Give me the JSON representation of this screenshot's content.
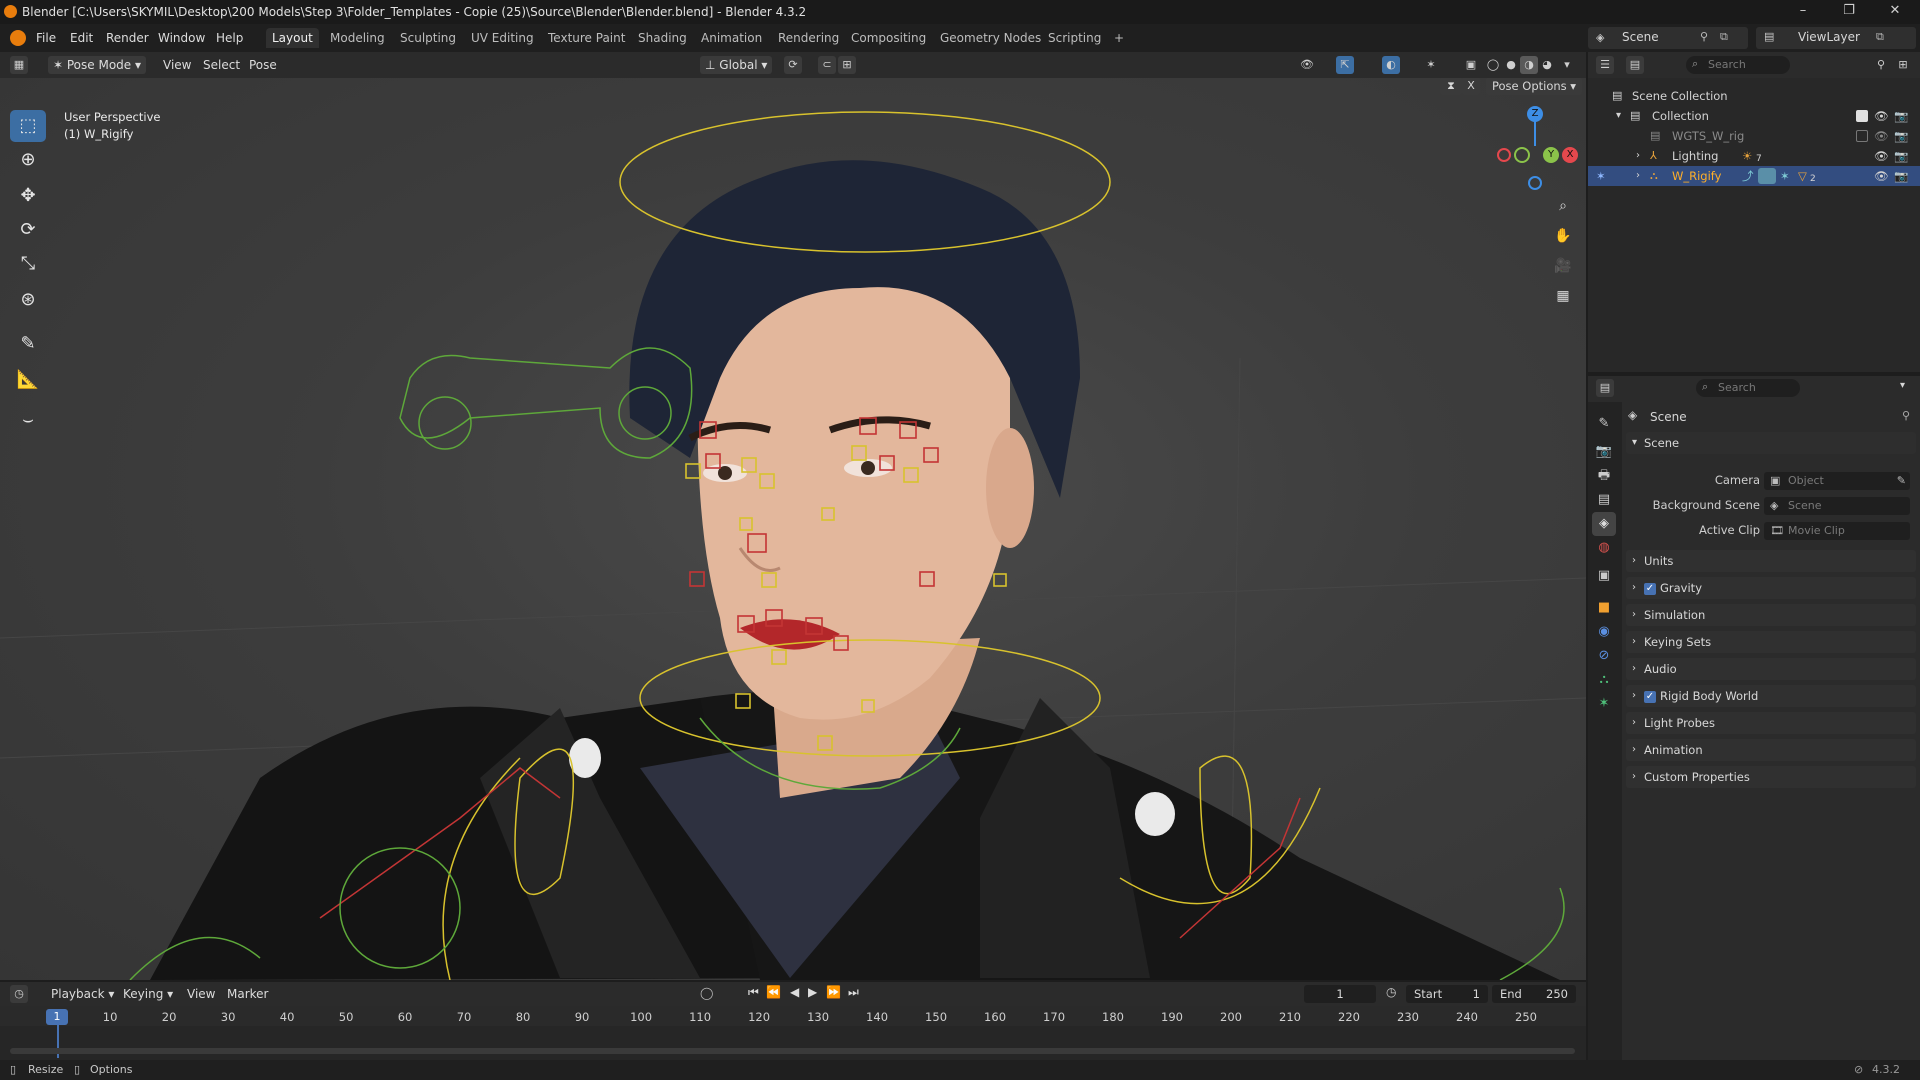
{
  "window": {
    "title": "Blender [C:\\Users\\SKYMIL\\Desktop\\200 Models\\Step 3\\Folder_Templates - Copie (25)\\Source\\Blender\\Blender.blend] - Blender 4.3.2",
    "controls": [
      "–",
      "❐",
      "✕"
    ]
  },
  "menubar": {
    "menus": [
      "File",
      "Edit",
      "Render",
      "Window",
      "Help"
    ],
    "workspaces": [
      "Layout",
      "Modeling",
      "Sculpting",
      "UV Editing",
      "Texture Paint",
      "Shading",
      "Animation",
      "Rendering",
      "Compositing",
      "Geometry Nodes",
      "Scripting"
    ],
    "active_workspace": "Layout",
    "add_tab": "+",
    "scene": "Scene",
    "view_layer": "ViewLayer"
  },
  "viewport_header": {
    "mode": "Pose Mode",
    "menus": [
      "View",
      "Select",
      "Pose"
    ],
    "orientation": "Global",
    "pose_options": "Pose Options"
  },
  "viewport": {
    "overlay_line1": "User Perspective",
    "overlay_line2": "(1) W_Rigify",
    "gizmo_axes": [
      "Z",
      "Y",
      "X"
    ],
    "accent_colors": {
      "x": "#e5484d",
      "y": "#8bc34a",
      "z": "#3d8ee6"
    }
  },
  "tools": [
    "select-box",
    "cursor",
    "move",
    "rotate",
    "scale",
    "transform",
    "annotate",
    "measure",
    "bone-relax"
  ],
  "outliner": {
    "search_placeholder": "Search",
    "root": "Scene Collection",
    "rows": [
      {
        "name": "Collection",
        "level": 1
      },
      {
        "name": "WGTS_W_rig",
        "level": 2
      },
      {
        "name": "Lighting",
        "level": 2,
        "badge": "7"
      },
      {
        "name": "W_Rigify",
        "level": 2,
        "badge": "2",
        "selected": true
      }
    ]
  },
  "properties": {
    "search_placeholder": "Search",
    "context": "Scene",
    "section": "Scene",
    "fields": [
      {
        "label": "Camera",
        "placeholder": "Object"
      },
      {
        "label": "Background Scene",
        "placeholder": "Scene"
      },
      {
        "label": "Active Clip",
        "placeholder": "Movie Clip"
      }
    ],
    "panels": [
      {
        "label": "Units",
        "checkbox": false
      },
      {
        "label": "Gravity",
        "checkbox": true
      },
      {
        "label": "Simulation",
        "checkbox": false
      },
      {
        "label": "Keying Sets",
        "checkbox": false
      },
      {
        "label": "Audio",
        "checkbox": false
      },
      {
        "label": "Rigid Body World",
        "checkbox": true
      },
      {
        "label": "Light Probes",
        "checkbox": false
      },
      {
        "label": "Animation",
        "checkbox": false
      },
      {
        "label": "Custom Properties",
        "checkbox": false
      }
    ]
  },
  "timeline": {
    "menus": [
      "Playback",
      "Keying",
      "View",
      "Marker"
    ],
    "current_frame": "1",
    "start_label": "Start",
    "start": "1",
    "end_label": "End",
    "end": "250",
    "ticks": [
      "1",
      "10",
      "20",
      "30",
      "40",
      "50",
      "60",
      "70",
      "80",
      "90",
      "100",
      "110",
      "120",
      "130",
      "140",
      "150",
      "160",
      "170",
      "180",
      "190",
      "200",
      "210",
      "220",
      "230",
      "240",
      "250"
    ]
  },
  "statusbar": {
    "left1": "Resize",
    "left2": "Options",
    "version": "4.3.2"
  }
}
